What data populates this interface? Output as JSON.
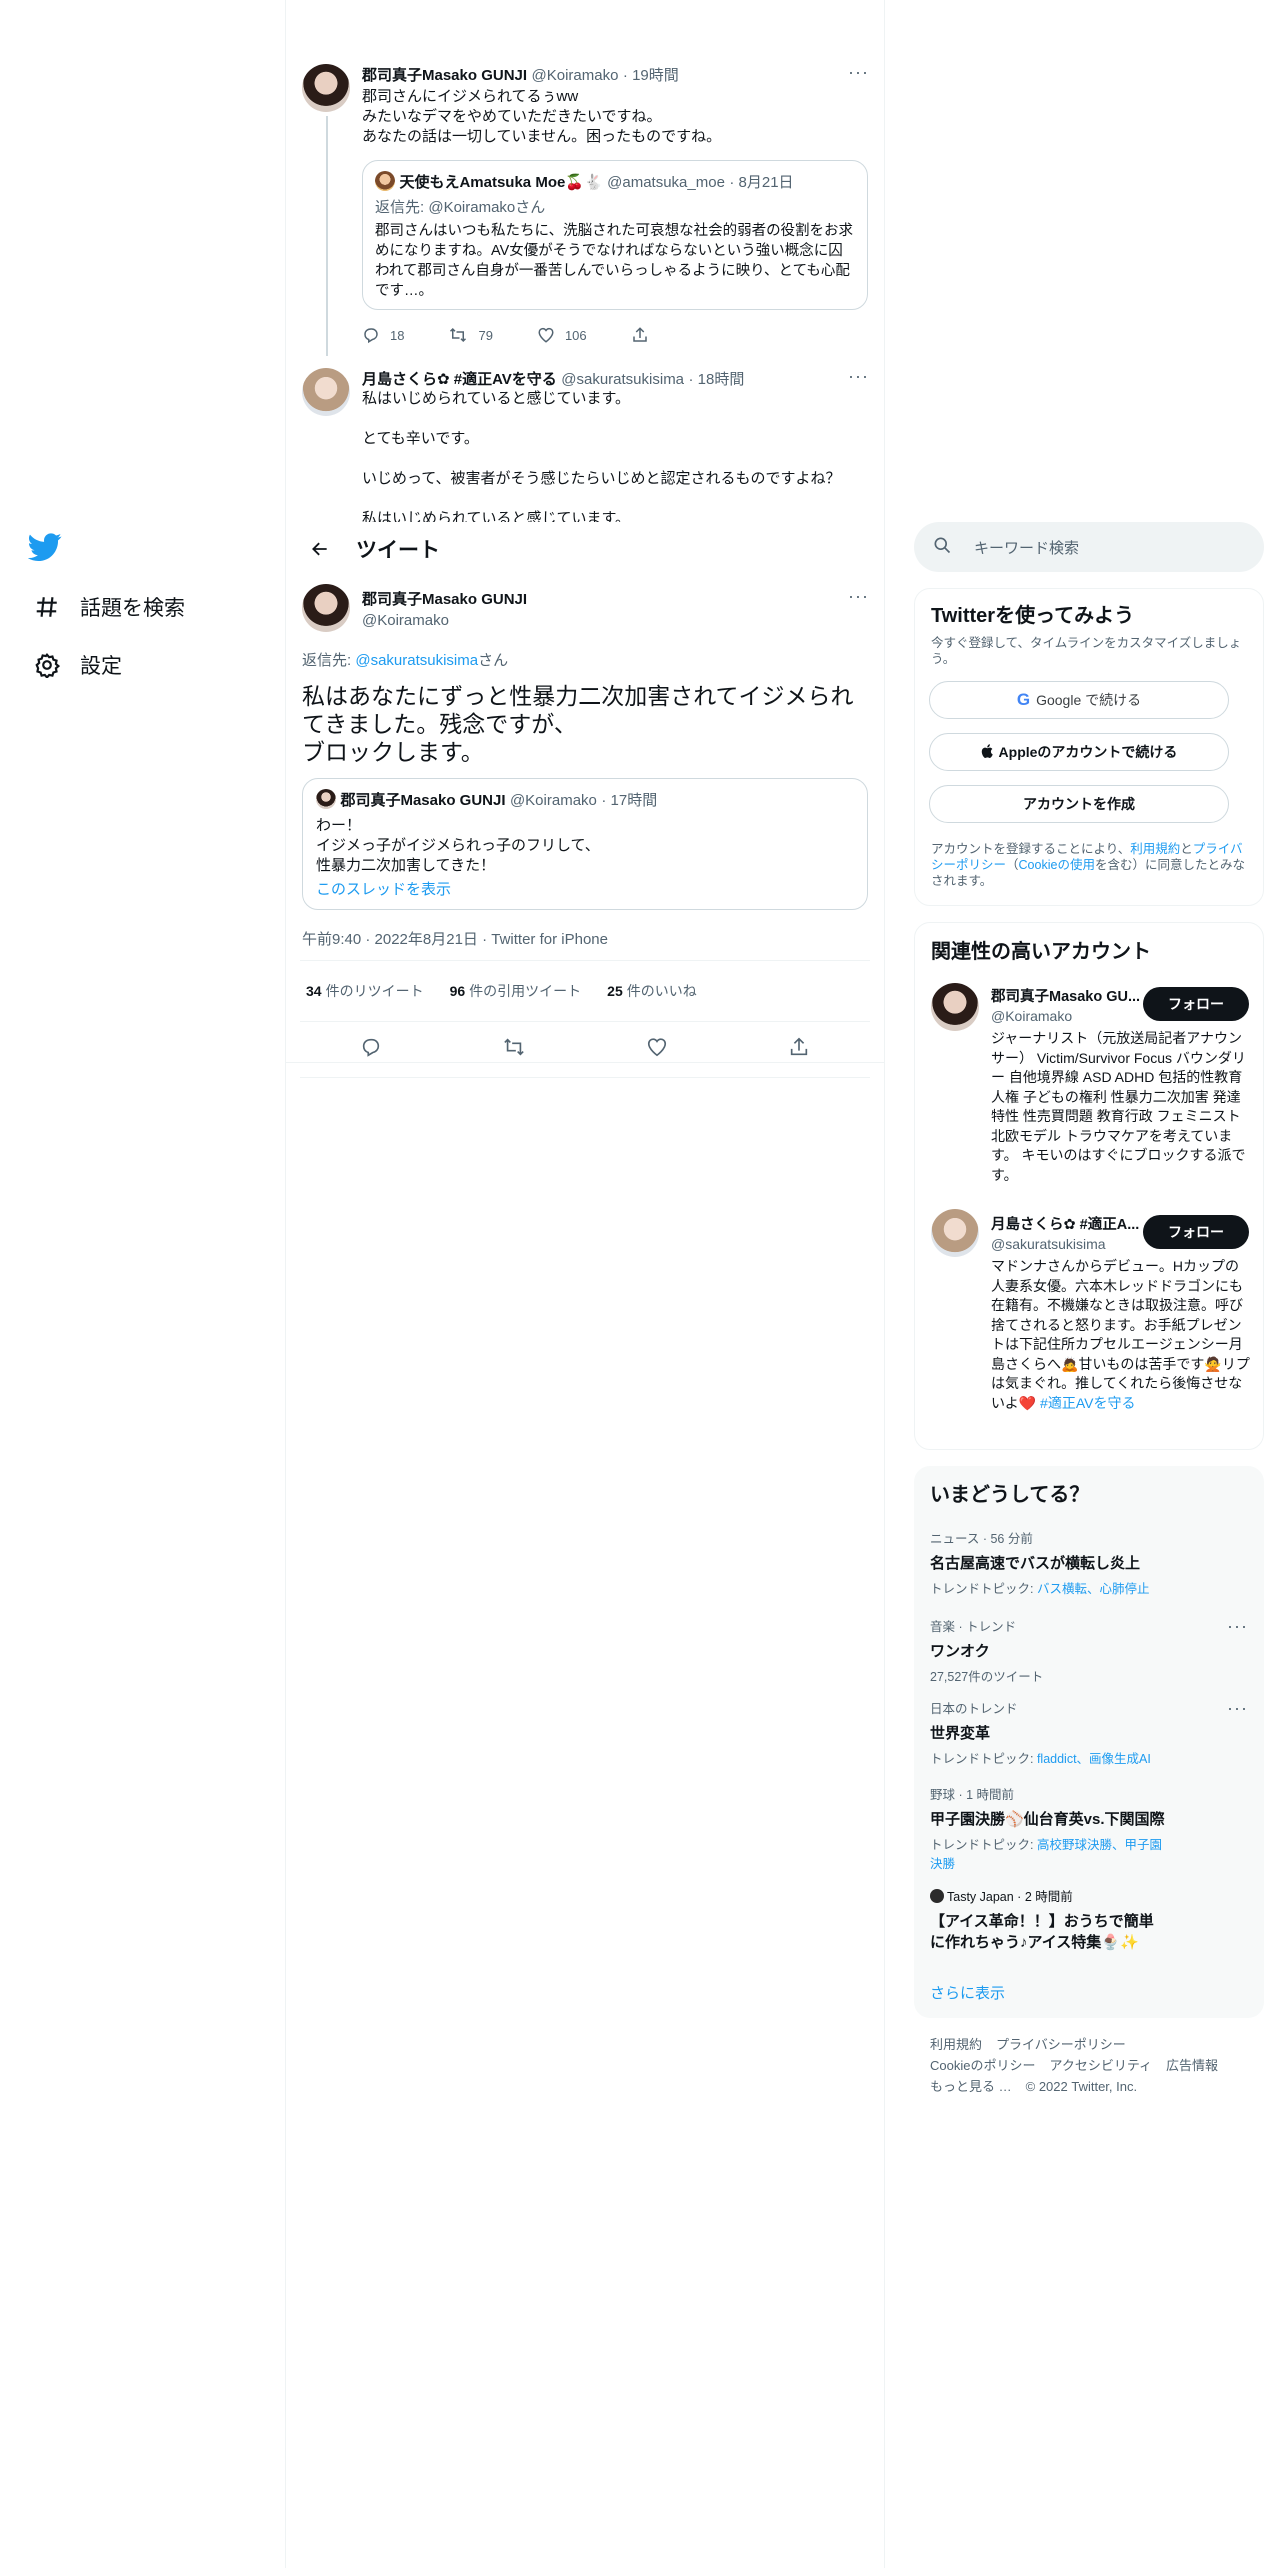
{
  "nav": {
    "explore_label": "話題を検索",
    "settings_label": "設定"
  },
  "header": {
    "title": "ツイート"
  },
  "thread": [
    {
      "name": "郡司真子Masako GUNJI",
      "handle": "@Koiramako",
      "time": "19時間",
      "text": "郡司さんにイジメられてるぅww\nみたいなデマをやめていただきたいですね。\nあなたの話は一切していません。困ったものですね。",
      "quote": {
        "name": "天使もえAmatsuka Moe🍒🐇",
        "handle": "@amatsuka_moe",
        "time": "8月21日",
        "reply_prefix": "返信先: ",
        "reply_to": "@Koiramako",
        "reply_suffix": "さん",
        "text": "郡司さんはいつも私たちに、洗脳された可哀想な社会的弱者の役割をお求めになりますね。AV女優がそうでなければならないという強い概念に囚われて郡司さん自身が一番苦しんでいらっしゃるように映り、とても心配です…。"
      },
      "replies": "18",
      "retweets": "79",
      "likes": "106"
    },
    {
      "name": "月島さくら✿ #適正AVを守る",
      "handle": "@sakuratsukisima",
      "time": "18時間",
      "text": "私はいじめられていると感じています。\n\nとても辛いです。\n\nいじめって、被害者がそう感じたらいじめと認定されるものですよね？\n\n私はいじめられていると感じています。"
    }
  ],
  "focus": {
    "name": "郡司真子Masako GUNJI",
    "handle": "@Koiramako",
    "reply_prefix": "返信先: ",
    "reply_to": "@sakuratsukisima",
    "reply_suffix": "さん",
    "text": "私はあなたにずっと性暴力二次加害されてイジメられてきました。残念ですが、\nブロックします。",
    "quote": {
      "name": "郡司真子Masako GUNJI",
      "handle": "@Koiramako",
      "time": "17時間",
      "text": "わー！\nイジメっ子がイジメられっ子のフリして、\n性暴力二次加害してきた！",
      "link": "このスレッドを表示"
    },
    "timestamp": "午前9:40 · 2022年8月21日 · Twitter for iPhone",
    "retweets": "34",
    "retweets_label": "件のリツイート",
    "quotes": "96",
    "quotes_label": "件の引用ツイート",
    "likes": "25",
    "likes_label": "件のいいね"
  },
  "search": {
    "placeholder": "キーワード検索"
  },
  "signup": {
    "title": "Twitterを使ってみよう",
    "subtitle": "今すぐ登録して、タイムラインをカスタマイズしましょう。",
    "google": "Google で続ける",
    "apple": "Appleのアカウントで続ける",
    "create": "アカウントを作成",
    "legal_1": "アカウントを登録することにより、",
    "legal_terms": "利用規約",
    "legal_2": "と",
    "legal_privacy": "プライバシーポリシー",
    "legal_3": "（",
    "legal_cookie": "Cookieの使用",
    "legal_4": "を含む）に同意したとみなされます。"
  },
  "relevant": {
    "title": "関連性の高いアカウント",
    "follow_label": "フォロー",
    "accounts": [
      {
        "name": "郡司真子Masako GU...",
        "handle": "@Koiramako",
        "bio": "ジャーナリスト（元放送局記者アナウンサー） Victim/Survivor Focus バウンダリー 自他境界線 ASD ADHD 包括的性教育 人権 子どもの権利 性暴力二次加害 発達特性 性売買問題 教育行政 フェミニスト 北欧モデル トラウマケアを考えています。 キモいのはすぐにブロックする派です。"
      },
      {
        "name": "月島さくら✿ #適正A...",
        "handle": "@sakuratsukisima",
        "bio": "マドンナさんからデビュー。Hカップの人妻系女優。六本木レッドドラゴンにも在籍有。不機嫌なときは取扱注意。呼び捨てされると怒ります。お手紙プレゼントは下記住所カプセルエージェンシー月島さくらへ🙇甘いものは苦手です🙅リプは気まぐれ。推してくれたら後悔させないよ❤️ ",
        "bio_tag": "#適正AVを守る"
      }
    ]
  },
  "trends": {
    "title": "いまどうしてる？",
    "show_more": "さらに表示",
    "items": [
      {
        "category": "ニュース · 56 分前",
        "title": "名古屋高速でバスが横転し炎上",
        "sub_prefix": "トレンドトピック: ",
        "sub_links": "バス横転、心肺停止"
      },
      {
        "category": "音楽 · トレンド",
        "title": "ワンオク",
        "sub_prefix": "27,527件のツイート",
        "sub_links": ""
      },
      {
        "category": "日本のトレンド",
        "title": "世界変革",
        "sub_prefix": "トレンドトピック: ",
        "sub_links": "fladdict、画像生成AI"
      },
      {
        "category": "野球 · 1 時間前",
        "title": "甲子園決勝⚾仙台育英vs.下関国際",
        "sub_prefix": "トレンドトピック: ",
        "sub_links": "高校野球決勝、甲子園決勝"
      },
      {
        "category": "Tasty Japan · 2 時間前",
        "title": "【アイス革命！！】おうちで簡単に作れちゃう♪アイス特集🍨✨",
        "sub_prefix": "",
        "sub_links": ""
      }
    ]
  },
  "footer": {
    "links": [
      "利用規約",
      "プライバシーポリシー",
      "Cookieのポリシー",
      "アクセシビリティ",
      "広告情報",
      "もっと見る …"
    ],
    "copyright": "© 2022 Twitter, Inc."
  },
  "colors": {
    "accent": "#1d9bf0",
    "text": "#0f1419",
    "muted": "#536471",
    "border": "#eff3f4"
  }
}
